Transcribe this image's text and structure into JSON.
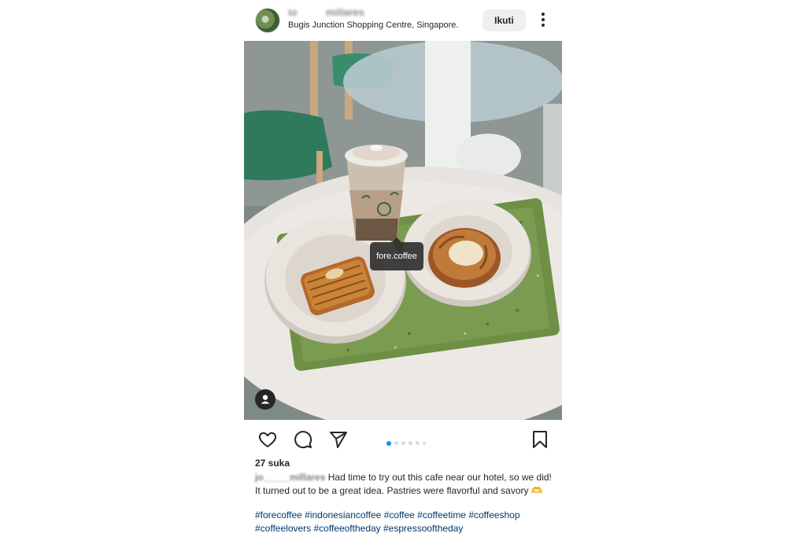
{
  "post": {
    "username": "jo_____millares",
    "location": "Bugis Junction Shopping Centre, Singapore.",
    "follow_label": "Ikuti",
    "photo_tag": "fore.coffee",
    "carousel": {
      "count": 6,
      "active_index": 0
    },
    "likes": "27 suka",
    "caption_user": "jo_____millares",
    "caption_text": " Had time to try out this cafe near our hotel, so we did! It turned out to be a great idea. Pastries were flavorful and savory 🫶",
    "hashtags_line1": "#forecoffee #indonesiancoffee #coffee #coffeetime #coffeeshop",
    "hashtags_line2": "#coffeelovers #coffeeoftheday #espressooftheday",
    "icons": {
      "like": "heart-icon",
      "comment": "comment-icon",
      "share": "send-icon",
      "save": "bookmark-icon",
      "more": "more-vertical-icon",
      "user_tag": "person-icon"
    },
    "colors": {
      "link": "#00376b",
      "active_dot": "#0095f6",
      "follow_bg": "#efefef"
    }
  }
}
